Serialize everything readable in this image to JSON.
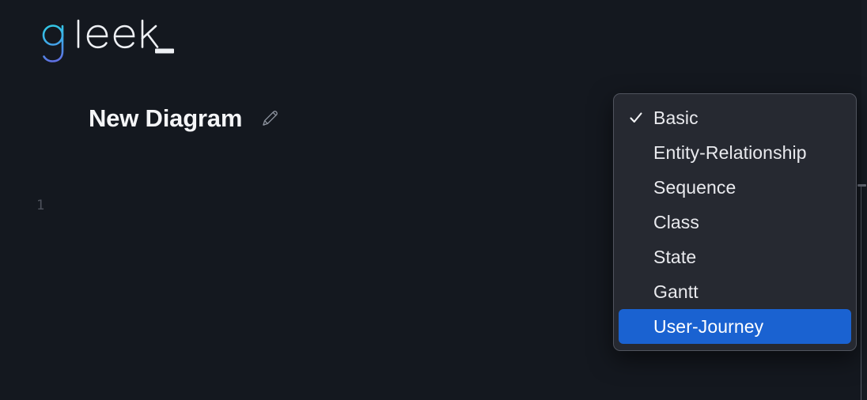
{
  "app": {
    "brand": {
      "name": "gleek_",
      "letter_g": "g",
      "rest": "leek",
      "cursor": "_",
      "gradient_start": "#2ed3e3",
      "gradient_end": "#5a6fe0",
      "text_color": "#f0f2f5"
    },
    "background_color": "#14181f"
  },
  "header": {
    "title": "New Diagram",
    "edit_icon": "pencil-icon"
  },
  "editor": {
    "line_numbers": [
      "1"
    ],
    "lines": [
      ""
    ]
  },
  "divider": {
    "grip_icon": "resize-grip-icon"
  },
  "diagram_type_menu": {
    "name": "diagram-type-select-popup",
    "selected_value": "User-Journey",
    "checked_value": "Basic",
    "highlight_color": "#1a62d1",
    "background_color": "#262931",
    "border_color": "#50545e",
    "check_icon": "check-icon",
    "options": [
      {
        "label": "Basic",
        "checked": true,
        "highlighted": false
      },
      {
        "label": "Entity-Relationship",
        "checked": false,
        "highlighted": false
      },
      {
        "label": "Sequence",
        "checked": false,
        "highlighted": false
      },
      {
        "label": "Class",
        "checked": false,
        "highlighted": false
      },
      {
        "label": "State",
        "checked": false,
        "highlighted": false
      },
      {
        "label": "Gantt",
        "checked": false,
        "highlighted": false
      },
      {
        "label": "User-Journey",
        "checked": false,
        "highlighted": true
      }
    ]
  }
}
